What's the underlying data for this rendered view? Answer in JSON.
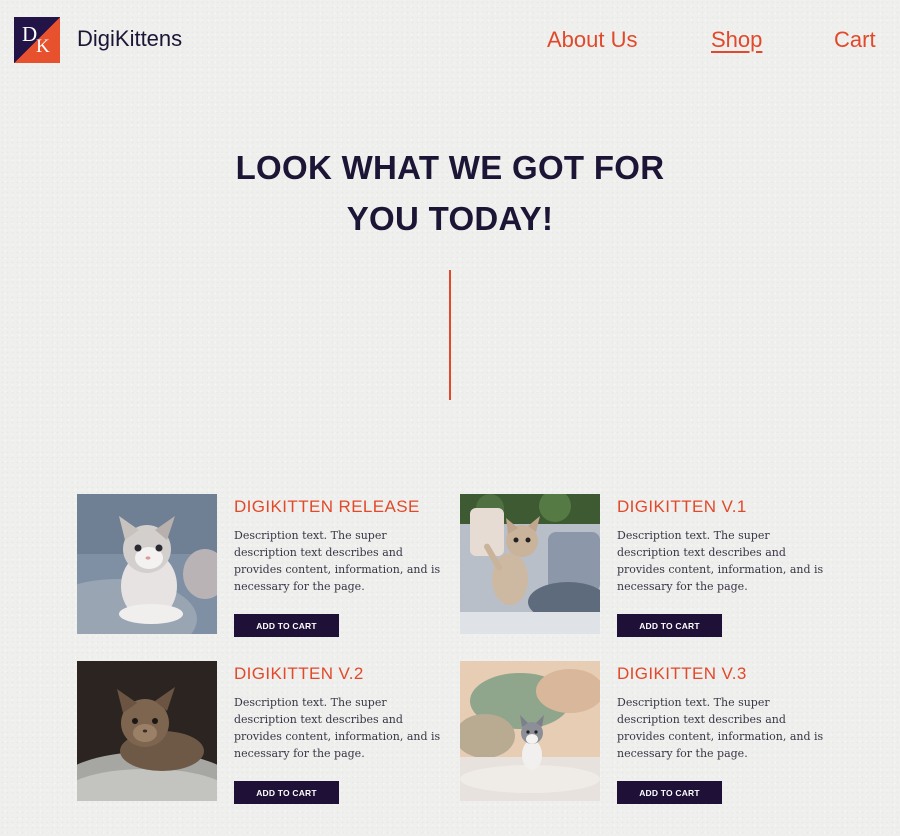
{
  "header": {
    "logo_letters": [
      "D",
      "K"
    ],
    "brand": "DigiKittens",
    "nav": [
      {
        "label": "About Us",
        "active": false
      },
      {
        "label": "Shop",
        "active": true
      },
      {
        "label": "Cart",
        "active": false
      }
    ]
  },
  "hero": {
    "title_line1": "LOOK WHAT WE GOT FOR",
    "title_line2": "YOU TODAY!"
  },
  "products": [
    {
      "name": "DIGIKITTEN RELEASE",
      "description": "Description text. The super description text describes and provides content, information, and is necessary for the page.",
      "button": "ADD TO CART"
    },
    {
      "name": "DIGIKITTEN V.1",
      "description": "Description text. The super description text describes and provides content, information, and is necessary for the page.",
      "button": "ADD TO CART"
    },
    {
      "name": "DIGIKITTEN V.2",
      "description": "Description text. The super description text describes and provides content, information, and is necessary for the page.",
      "button": "ADD TO CART"
    },
    {
      "name": "DIGIKITTEN V.3",
      "description": "Description text. The super description text describes and provides content, information, and is necessary for the page.",
      "button": "ADD TO CART"
    }
  ],
  "colors": {
    "accent": "#e2492a",
    "navy": "#1e1036",
    "background": "#efefed"
  }
}
